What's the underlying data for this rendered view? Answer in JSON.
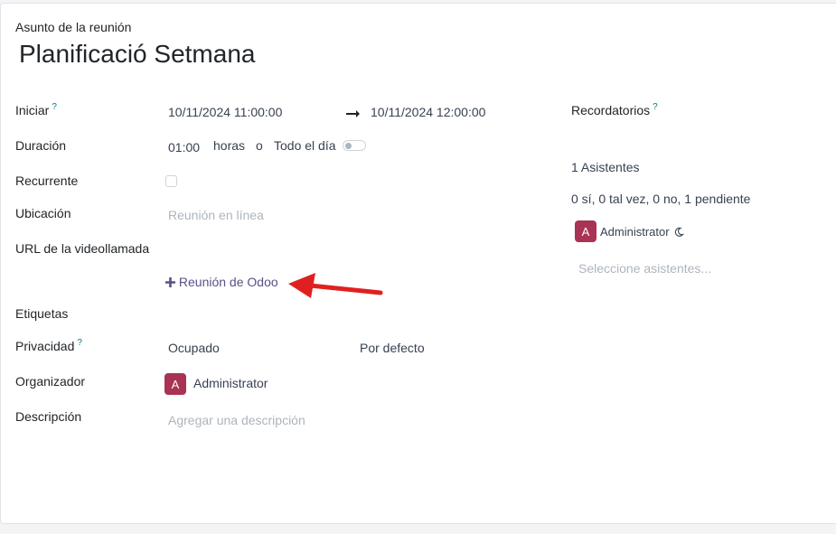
{
  "form": {
    "subject_label": "Asunto de la reunión",
    "title": "Planificació Setmana"
  },
  "fields": {
    "start": {
      "label": "Iniciar",
      "help": "?",
      "from": "10/11/2024 11:00:00",
      "to": "10/11/2024 12:00:00"
    },
    "duration": {
      "label": "Duración",
      "value": "01:00",
      "unit": "horas",
      "or": "o",
      "all_day": "Todo el día"
    },
    "recurrent": {
      "label": "Recurrente"
    },
    "location": {
      "label": "Ubicación",
      "placeholder": "Reunión en línea"
    },
    "video_url": {
      "label": "URL de la videollamada",
      "button": "Reunión de Odoo"
    },
    "tags": {
      "label": "Etiquetas"
    },
    "privacy": {
      "label": "Privacidad",
      "help": "?",
      "show_as": "Ocupado",
      "privacy_value": "Por defecto"
    },
    "organizer": {
      "label": "Organizador",
      "initial": "A",
      "name": "Administrator"
    },
    "description": {
      "label": "Descripción",
      "placeholder": "Agregar una descripción"
    }
  },
  "side": {
    "reminders_label": "Recordatorios",
    "reminders_help": "?",
    "attendees_count": "1 Asistentes",
    "attendees_summary": "0 sí, 0 tal vez, 0 no, 1 pendiente",
    "attendee": {
      "initial": "A",
      "name": "Administrator"
    },
    "attendees_placeholder": "Seleccione asistentes..."
  },
  "colors": {
    "avatar": "#a93353",
    "link": "#5b4f87",
    "arrow": "#e02020"
  },
  "icons": {
    "arrow": "long-right-arrow-icon",
    "plus": "plus-icon",
    "moon": "moon-icon",
    "annotation": "red-arrow-annotation"
  }
}
